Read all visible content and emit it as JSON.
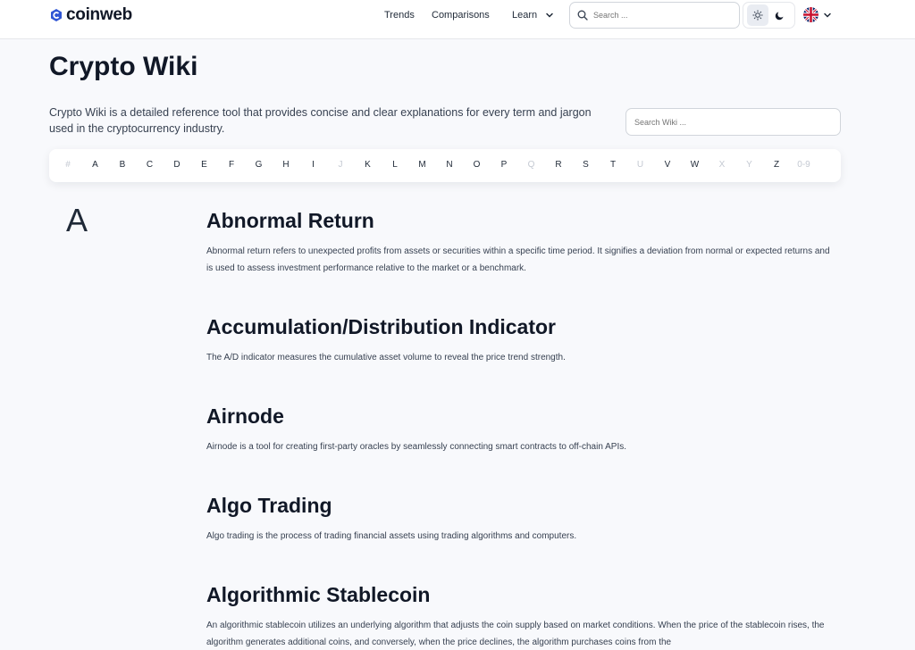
{
  "header": {
    "logo_text": "coinweb",
    "nav": {
      "trends": "Trends",
      "comparisons": "Comparisons",
      "learn": "Learn"
    },
    "search_placeholder": "Search ...",
    "theme": {
      "active": "light"
    },
    "language": "en-GB"
  },
  "page": {
    "title": "Crypto Wiki",
    "intro": "Crypto Wiki is a detailed reference tool that provides concise and clear explanations for every term and jargon used in the cryptocurrency industry.",
    "wiki_search_placeholder": "Search Wiki ..."
  },
  "alphabet": [
    {
      "label": "#",
      "enabled": false
    },
    {
      "label": "A",
      "enabled": true
    },
    {
      "label": "B",
      "enabled": true
    },
    {
      "label": "C",
      "enabled": true
    },
    {
      "label": "D",
      "enabled": true
    },
    {
      "label": "E",
      "enabled": true
    },
    {
      "label": "F",
      "enabled": true
    },
    {
      "label": "G",
      "enabled": true
    },
    {
      "label": "H",
      "enabled": true
    },
    {
      "label": "I",
      "enabled": true
    },
    {
      "label": "J",
      "enabled": false
    },
    {
      "label": "K",
      "enabled": true
    },
    {
      "label": "L",
      "enabled": true
    },
    {
      "label": "M",
      "enabled": true
    },
    {
      "label": "N",
      "enabled": true
    },
    {
      "label": "O",
      "enabled": true
    },
    {
      "label": "P",
      "enabled": true
    },
    {
      "label": "Q",
      "enabled": false
    },
    {
      "label": "R",
      "enabled": true
    },
    {
      "label": "S",
      "enabled": true
    },
    {
      "label": "T",
      "enabled": true
    },
    {
      "label": "U",
      "enabled": false
    },
    {
      "label": "V",
      "enabled": true
    },
    {
      "label": "W",
      "enabled": true
    },
    {
      "label": "X",
      "enabled": false
    },
    {
      "label": "Y",
      "enabled": false
    },
    {
      "label": "Z",
      "enabled": true
    },
    {
      "label": "0-9",
      "enabled": false
    }
  ],
  "section_letter": "A",
  "entries": [
    {
      "title": "Abnormal Return",
      "description": "Abnormal return refers to unexpected profits from assets or securities within a specific time period. It signifies a deviation from normal or expected returns and is used to assess investment performance relative to the market or a benchmark."
    },
    {
      "title": "Accumulation/Distribution Indicator",
      "description": "The A/D indicator measures the cumulative asset volume to reveal the price trend strength."
    },
    {
      "title": "Airnode",
      "description": "Airnode is a tool for creating first-party oracles by seamlessly connecting smart contracts to off-chain APIs."
    },
    {
      "title": "Algo Trading",
      "description": "Algo trading is the process of trading financial assets using trading algorithms and computers."
    },
    {
      "title": "Algorithmic Stablecoin",
      "description": "An algorithmic stablecoin utilizes an underlying algorithm that adjusts the coin supply based on market conditions. When the price of the stablecoin rises, the algorithm generates additional coins, and conversely, when the price declines, the algorithm purchases coins from the"
    }
  ],
  "colors": {
    "accent": "#2f55d4",
    "background": "#f8f9fc",
    "text": "#111827",
    "muted": "#c4c9d2"
  }
}
